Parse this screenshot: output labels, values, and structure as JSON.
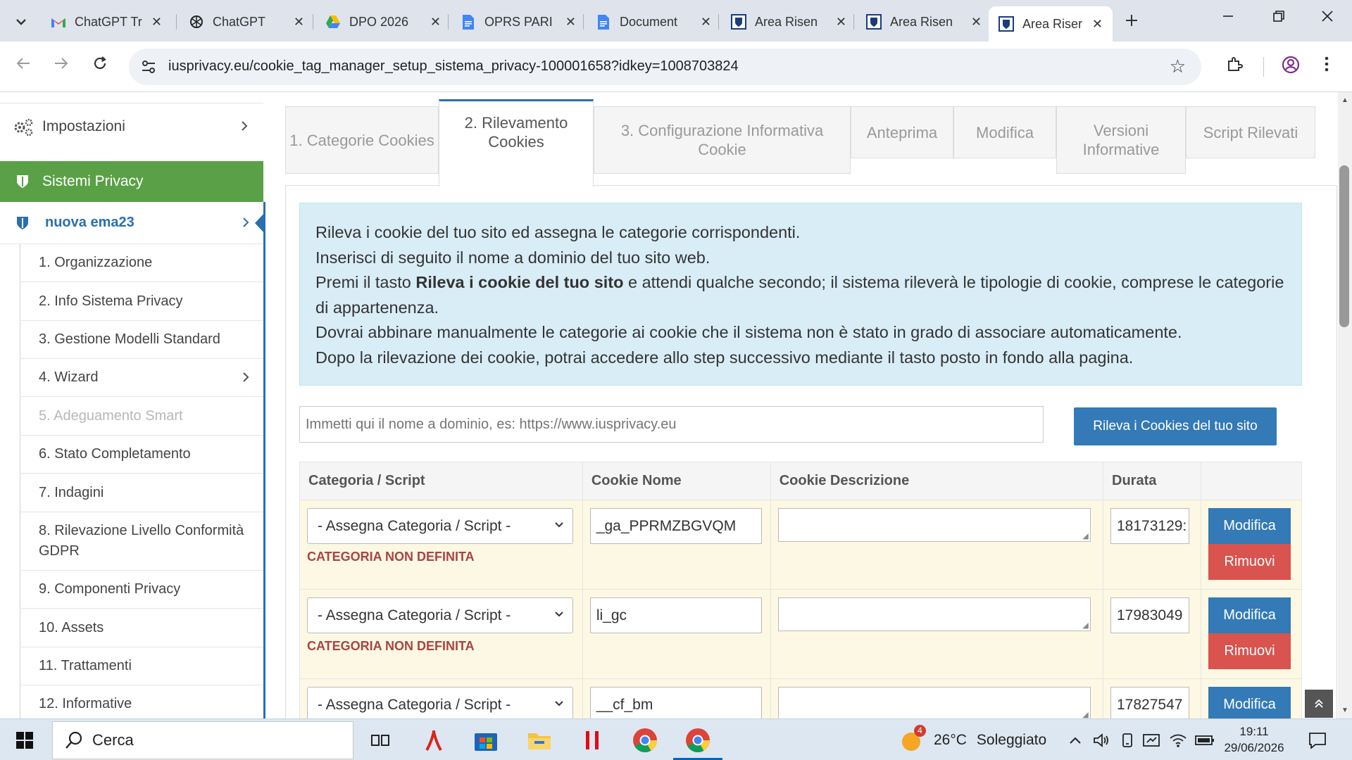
{
  "browser": {
    "tabs": [
      {
        "title": "ChatGPT Tr",
        "icon": "gmail-icon"
      },
      {
        "title": "ChatGPT",
        "icon": "chatgpt-icon"
      },
      {
        "title": "DPO 2026",
        "icon": "drive-icon"
      },
      {
        "title": "OPRS PARI",
        "icon": "docs-icon"
      },
      {
        "title": "Document",
        "icon": "docs-icon"
      },
      {
        "title": "Area Risen",
        "icon": "iusprivacy-icon"
      },
      {
        "title": "Area Risen",
        "icon": "iusprivacy-icon"
      },
      {
        "title": "Area Riser",
        "icon": "iusprivacy-icon",
        "active": true
      }
    ],
    "url": "iusprivacy.eu/cookie_tag_manager_setup_sistema_privacy-100001658?idkey=1008703824"
  },
  "sidebar": {
    "settings_label": "Impostazioni",
    "section_label": "Sistemi Privacy",
    "current_system": "nuova ema23",
    "items": [
      {
        "label": "1. Organizzazione"
      },
      {
        "label": "2. Info Sistema Privacy"
      },
      {
        "label": "3. Gestione Modelli Standard"
      },
      {
        "label": "4. Wizard"
      },
      {
        "label": "5. Adeguamento Smart"
      },
      {
        "label": "6. Stato Completamento"
      },
      {
        "label": "7. Indagini"
      },
      {
        "label": "8. Rilevazione Livello Conformità GDPR"
      },
      {
        "label": "9. Componenti Privacy"
      },
      {
        "label": "10. Assets"
      },
      {
        "label": "11. Trattamenti"
      },
      {
        "label": "12. Informative"
      }
    ]
  },
  "page_tabs": [
    {
      "label": "1. Categorie Cookies"
    },
    {
      "label": "2. Rilevamento Cookies",
      "active": true
    },
    {
      "label": "3. Configurazione Informativa Cookie"
    },
    {
      "label": "Anteprima"
    },
    {
      "label": "Modifica"
    },
    {
      "label": "Versioni Informative"
    },
    {
      "label": "Script Rilevati"
    }
  ],
  "info": {
    "line1": "Rileva i cookie del tuo sito ed assegna le categorie corrispondenti.",
    "line2": "Inserisci di seguito il nome a dominio del tuo sito web.",
    "line3_pre": "Premi il tasto ",
    "line3_bold": "Rileva i cookie del tuo sito",
    "line3_post": " e attendi qualche secondo; il sistema rileverà le tipologie di cookie, comprese le categorie di appartenenza.",
    "line4": "Dovrai abbinare manualmente le categorie ai cookie che il sistema non è stato in grado di associare automaticamente.",
    "line5": "Dopo la rilevazione dei cookie, potrai accedere allo step successivo mediante il tasto posto in fondo alla pagina."
  },
  "domain_input": {
    "placeholder": "Immetti qui il nome a dominio, es: https://www.iusprivacy.eu",
    "value": ""
  },
  "detect_button": "Rileva i Cookies del tuo sito",
  "table": {
    "headers": [
      "Categoria / Script",
      "Cookie Nome",
      "Cookie Descrizione",
      "Durata",
      ""
    ],
    "rows": [
      {
        "category": "- Assegna Categoria / Script -",
        "status": "CATEGORIA NON DEFINITA",
        "name": "_ga_PPRMZBGVQM",
        "description": "",
        "duration": "18173129:",
        "edit": "Modifica",
        "remove": "Rimuovi"
      },
      {
        "category": "- Assegna Categoria / Script -",
        "status": "CATEGORIA NON DEFINITA",
        "name": "li_gc",
        "description": "",
        "duration": "17983049",
        "edit": "Modifica",
        "remove": "Rimuovi"
      },
      {
        "category": "- Assegna Categoria / Script -",
        "status": "",
        "name": "__cf_bm",
        "description": "",
        "duration": "17827547",
        "edit": "Modifica",
        "remove": ""
      }
    ]
  },
  "taskbar": {
    "search_label": "Cerca",
    "weather_badge": "4",
    "temperature": "26°C",
    "weather_text": "Soleggiato",
    "time": "19:11",
    "date": "29/06/2026"
  },
  "colors": {
    "primary": "#337ab7",
    "success": "#5aa046",
    "danger": "#d9534f",
    "info_bg": "#d9edf7",
    "warning_row": "#fcf8e3"
  }
}
